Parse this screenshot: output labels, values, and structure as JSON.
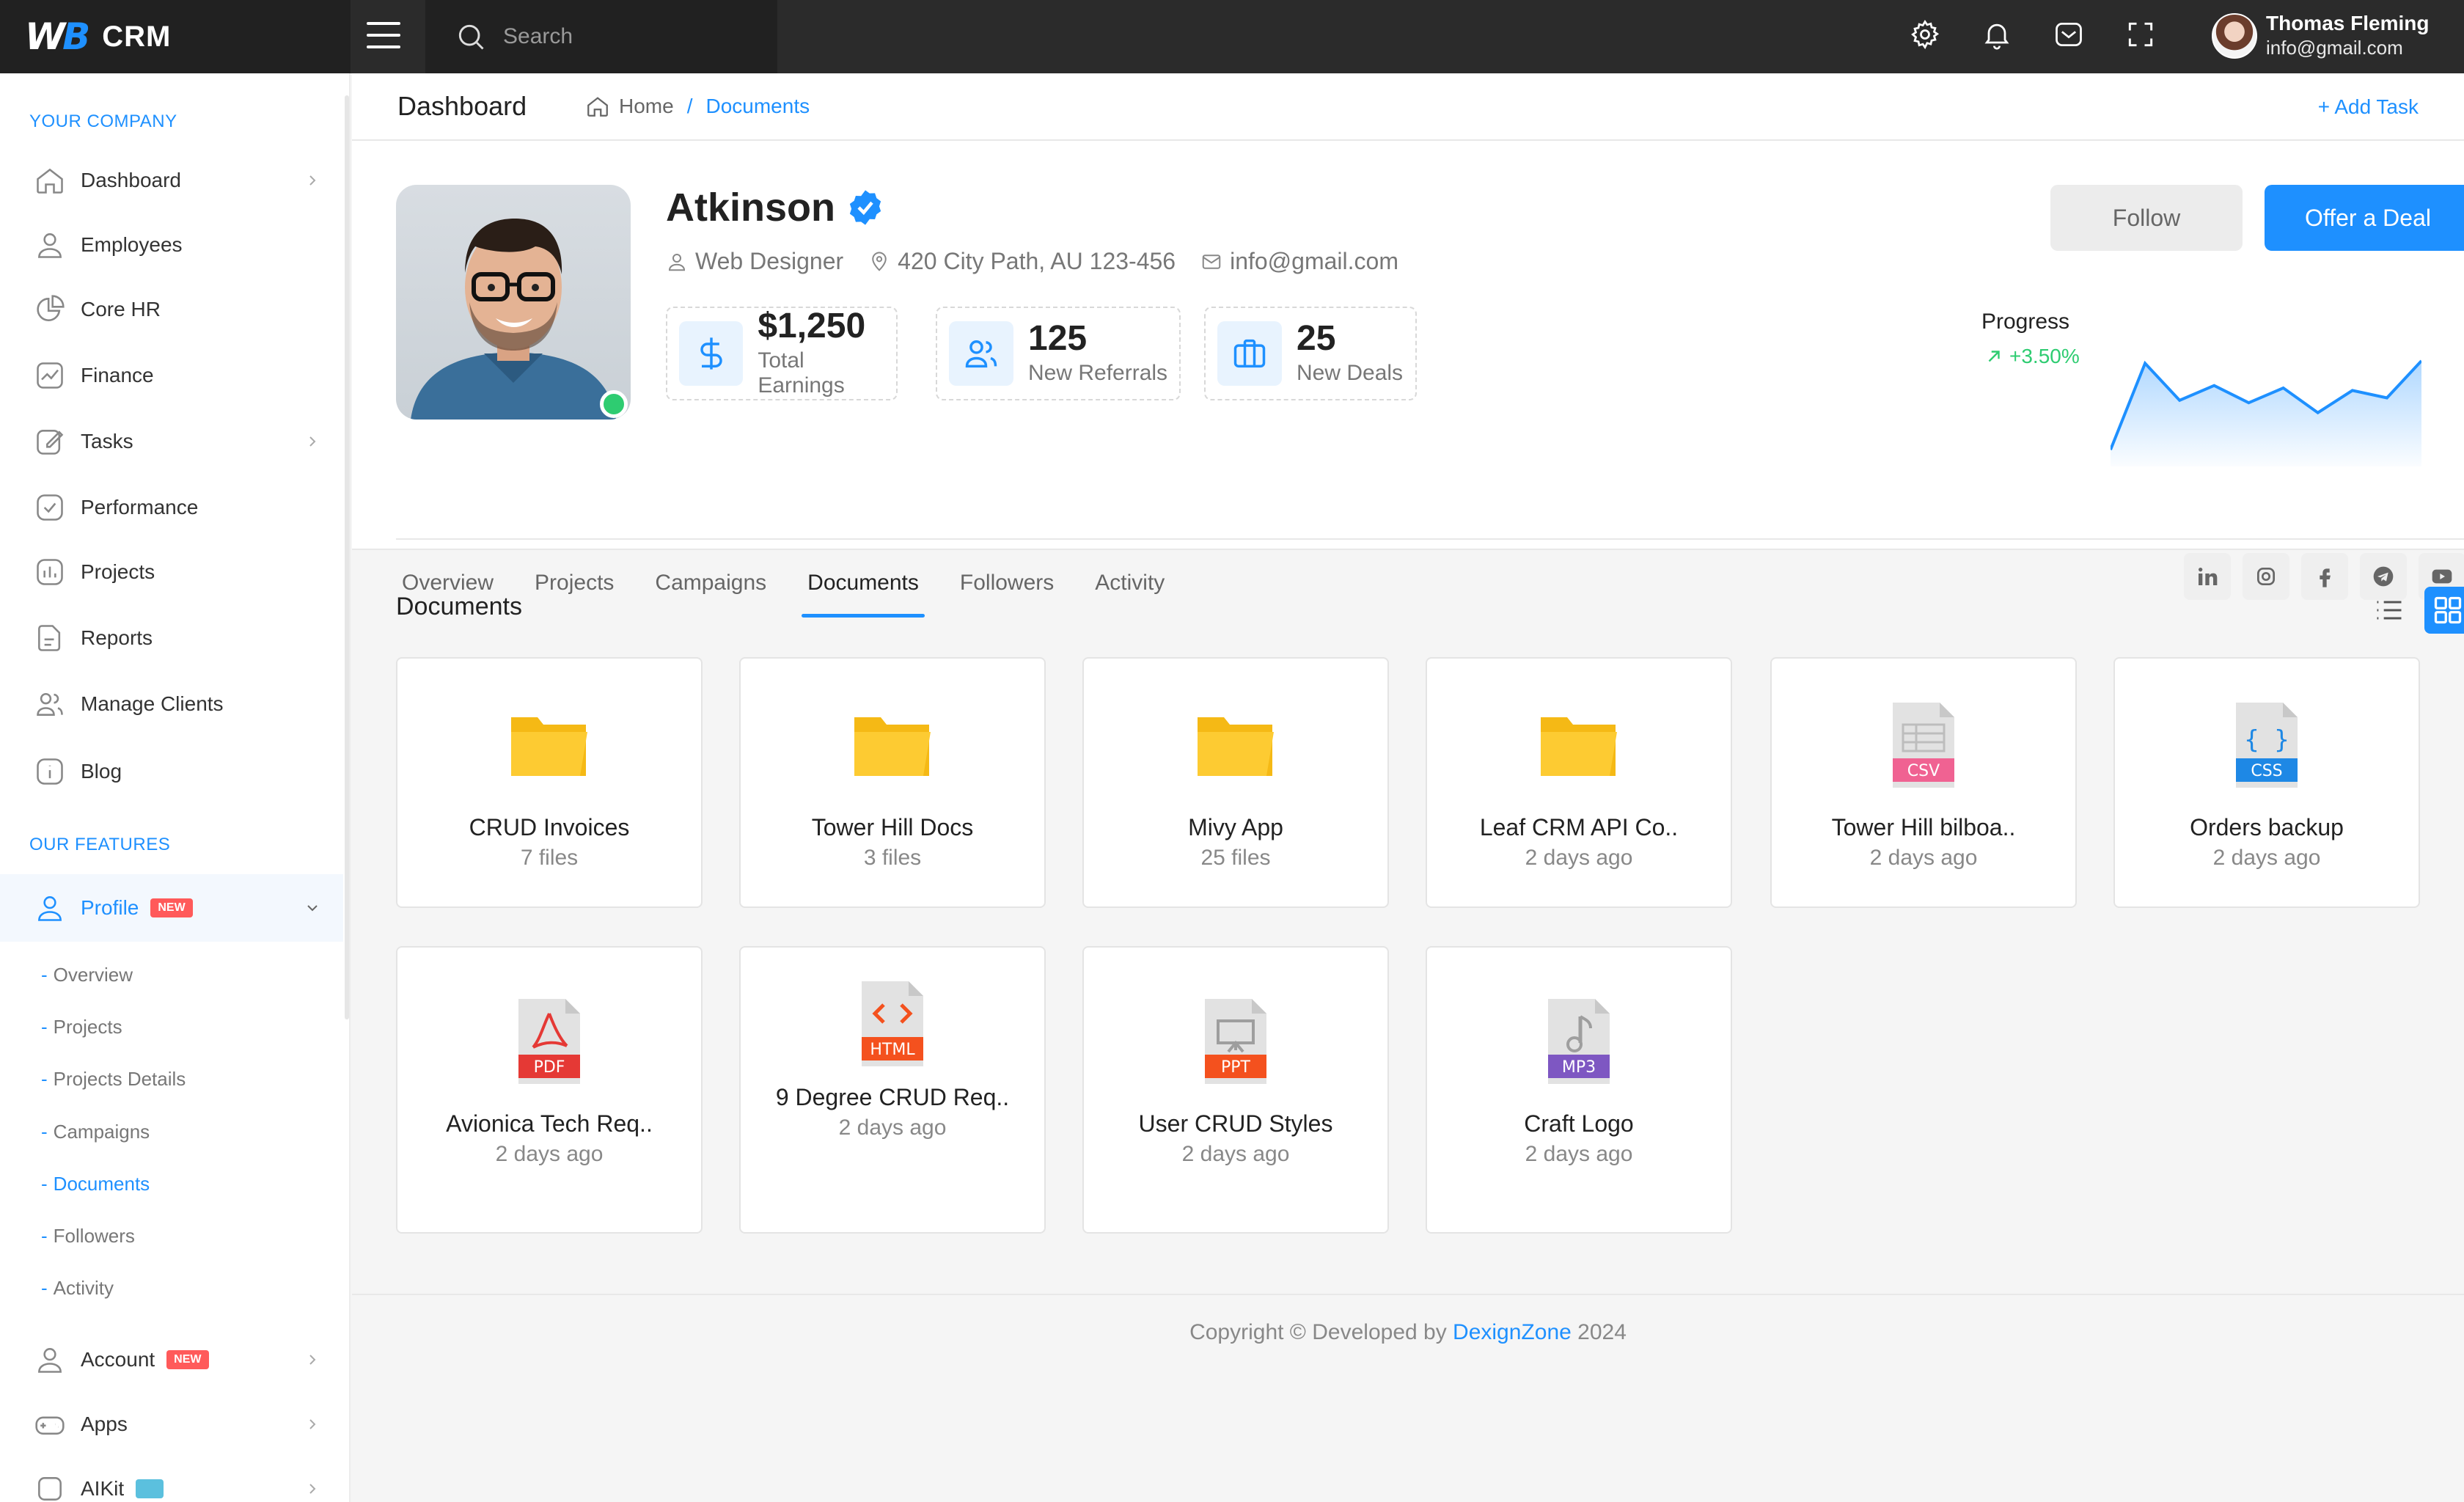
{
  "brand": {
    "logo": "WB",
    "name": "CRM"
  },
  "search": {
    "placeholder": "Search"
  },
  "user": {
    "name": "Thomas Fleming",
    "email": "info@gmail.com"
  },
  "sidebar": {
    "section1": "YOUR COMPANY",
    "section2": "OUR FEATURES",
    "items": [
      {
        "label": "Dashboard",
        "icon": "home-icon"
      },
      {
        "label": "Employees",
        "icon": "user-icon"
      },
      {
        "label": "Core HR",
        "icon": "pie-chart-icon"
      },
      {
        "label": "Finance",
        "icon": "line-chart-icon"
      },
      {
        "label": "Tasks",
        "icon": "edit-icon"
      },
      {
        "label": "Performance",
        "icon": "check-square-icon"
      },
      {
        "label": "Projects",
        "icon": "bar-chart-icon"
      },
      {
        "label": "Reports",
        "icon": "file-icon"
      },
      {
        "label": "Manage Clients",
        "icon": "users-icon"
      },
      {
        "label": "Blog",
        "icon": "info-icon"
      }
    ],
    "profile": {
      "label": "Profile",
      "badge": "NEW"
    },
    "profile_sub": [
      "Overview",
      "Projects",
      "Projects Details",
      "Campaigns",
      "Documents",
      "Followers",
      "Activity"
    ],
    "account": {
      "label": "Account",
      "badge": "NEW"
    },
    "apps": {
      "label": "Apps"
    },
    "aikit": {
      "label": "AIKit"
    }
  },
  "header": {
    "title": "Dashboard",
    "breadcrumb_home": "Home",
    "breadcrumb_sep": "/",
    "breadcrumb_current": "Documents",
    "add_task": "+ Add Task"
  },
  "profile": {
    "name": "Atkinson",
    "role": "Web Designer",
    "location": "420 City Path, AU 123-456",
    "email": "info@gmail.com",
    "stats": [
      {
        "value": "$1,250",
        "label": "Total Earnings"
      },
      {
        "value": "125",
        "label": "New Referrals"
      },
      {
        "value": "25",
        "label": "New Deals"
      }
    ],
    "follow": "Follow",
    "offer": "Offer a Deal",
    "progress_label": "Progress",
    "progress_change": "+3.50%",
    "sparkline": [
      10,
      80,
      50,
      62,
      48,
      60,
      40,
      58,
      52,
      82
    ],
    "colors": {
      "accent": "#1e90ff",
      "positive": "#2ecc71"
    }
  },
  "tabs": [
    "Overview",
    "Projects",
    "Campaigns",
    "Documents",
    "Followers",
    "Activity"
  ],
  "active_tab": "Documents",
  "socials": [
    "linkedin-icon",
    "instagram-icon",
    "facebook-icon",
    "telegram-icon",
    "youtube-icon"
  ],
  "documents": {
    "title": "Documents",
    "items": [
      {
        "name": "CRUD Invoices",
        "sub": "7 files",
        "type": "folder"
      },
      {
        "name": "Tower Hill Docs",
        "sub": "3 files",
        "type": "folder"
      },
      {
        "name": "Mivy App",
        "sub": "25 files",
        "type": "folder"
      },
      {
        "name": "Leaf CRM API Co..",
        "sub": "2 days ago",
        "type": "folder"
      },
      {
        "name": "Tower Hill bilboa..",
        "sub": "2 days ago",
        "type": "csv",
        "tag": "CSV"
      },
      {
        "name": "Orders backup",
        "sub": "2 days ago",
        "type": "css",
        "tag": "CSS"
      },
      {
        "name": "Avionica Tech Req..",
        "sub": "2 days ago",
        "type": "pdf",
        "tag": "PDF"
      },
      {
        "name": "9 Degree CRUD Req..",
        "sub": "2 days ago",
        "type": "html",
        "tag": "HTML"
      },
      {
        "name": "User CRUD Styles",
        "sub": "2 days ago",
        "type": "ppt",
        "tag": "PPT"
      },
      {
        "name": "Craft Logo",
        "sub": "2 days ago",
        "type": "mp3",
        "tag": "MP3"
      }
    ]
  },
  "footer": {
    "prefix": "Copyright © Developed by",
    "link": "DexignZone",
    "year": "2024"
  }
}
